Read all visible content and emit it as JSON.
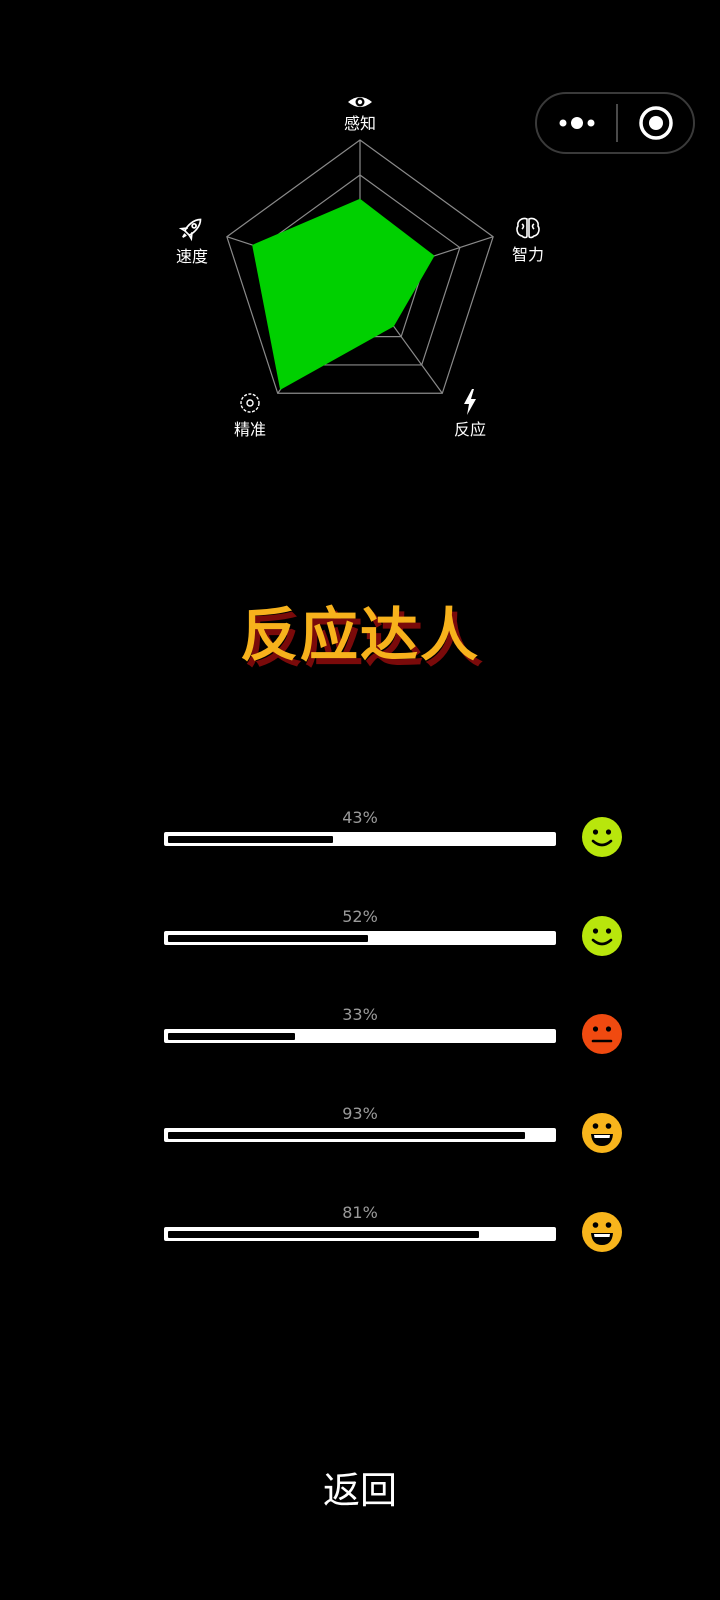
{
  "capsule": {
    "more_icon": "more-dots-icon",
    "close_icon": "target-circle-icon"
  },
  "radar": {
    "axes": [
      {
        "label": "感知",
        "icon": "eye-icon"
      },
      {
        "label": "智力",
        "icon": "brain-icon"
      },
      {
        "label": "反应",
        "icon": "lightning-icon"
      },
      {
        "label": "精准",
        "icon": "crosshair-icon"
      },
      {
        "label": "速度",
        "icon": "rocket-icon"
      }
    ],
    "values": [
      0.58,
      0.56,
      0.41,
      0.97,
      0.81
    ],
    "rings": 4,
    "fill_color": "#00d000",
    "grid_color": "#8a8a8a"
  },
  "title": "反应达人",
  "title_color": "#f7b21c",
  "bars": [
    {
      "percent_label": "43%",
      "value": 0.43,
      "face": "smile-face-icon",
      "face_color": "#b8e60c"
    },
    {
      "percent_label": "52%",
      "value": 0.52,
      "face": "smile-face-icon",
      "face_color": "#b8e60c"
    },
    {
      "percent_label": "33%",
      "value": 0.33,
      "face": "neutral-face-icon",
      "face_color": "#f04a10"
    },
    {
      "percent_label": "93%",
      "value": 0.93,
      "face": "grin-face-icon",
      "face_color": "#f8b51c"
    },
    {
      "percent_label": "81%",
      "value": 0.81,
      "face": "grin-face-icon",
      "face_color": "#f8b51c"
    }
  ],
  "back_button": "返回"
}
